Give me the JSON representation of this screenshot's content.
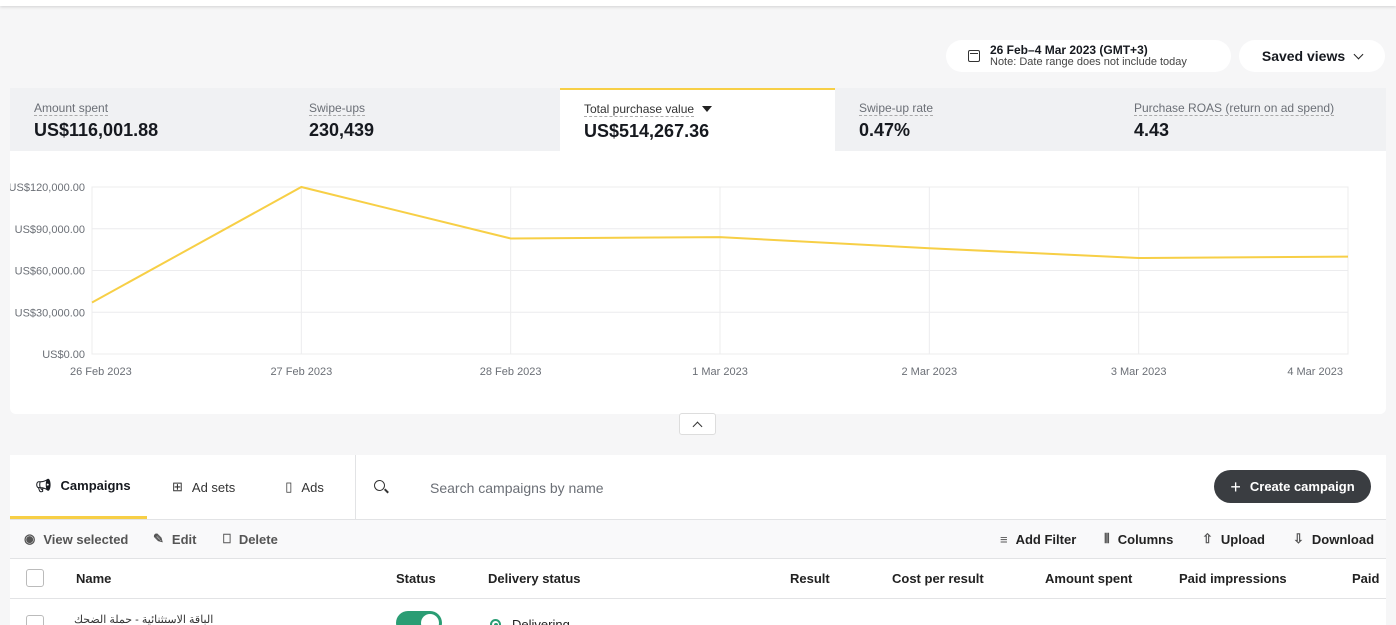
{
  "header": {
    "date_range": "26 Feb–4 Mar 2023 (GMT+3)",
    "date_note": "Note: Date range does not include today",
    "saved_views_label": "Saved views"
  },
  "metrics": [
    {
      "label": "Amount spent",
      "value": "US$116,001.88",
      "active": false
    },
    {
      "label": "Swipe-ups",
      "value": "230,439",
      "active": false
    },
    {
      "label": "Total purchase value",
      "value": "US$514,267.36",
      "active": true
    },
    {
      "label": "Swipe-up rate",
      "value": "0.47%",
      "active": false
    },
    {
      "label": "Purchase ROAS (return on ad spend)",
      "value": "4.43",
      "active": false
    }
  ],
  "chart_data": {
    "type": "line",
    "x": [
      "26 Feb 2023",
      "27 Feb 2023",
      "28 Feb 2023",
      "1 Mar 2023",
      "2 Mar 2023",
      "3 Mar 2023",
      "4 Mar 2023"
    ],
    "series": [
      {
        "values": [
          37000,
          120000,
          83000,
          84000,
          76000,
          69000,
          70000
        ]
      }
    ],
    "y_ticks": [
      "US$0.00",
      "US$30,000.00",
      "US$60,000.00",
      "US$90,000.00",
      "US$120,000.00"
    ],
    "ylim": [
      0,
      120000
    ],
    "color": "#f7cf46",
    "grid": true
  },
  "tabs": [
    {
      "label": "Campaigns",
      "icon": "megaphone-icon",
      "active": true
    },
    {
      "label": "Ad sets",
      "icon": "grid-icon",
      "active": false
    },
    {
      "label": "Ads",
      "icon": "phone-icon",
      "active": false
    }
  ],
  "search": {
    "placeholder": "Search campaigns by name"
  },
  "create_button": "Create campaign",
  "toolbar": {
    "view_selected": "View selected",
    "edit": "Edit",
    "delete": "Delete",
    "add_filter": "Add Filter",
    "columns": "Columns",
    "upload": "Upload",
    "download": "Download"
  },
  "table": {
    "columns": [
      "Name",
      "Status",
      "Delivery status",
      "Result",
      "Cost per result",
      "Amount spent",
      "Paid impressions",
      "Paid"
    ],
    "rows": [
      {
        "name": "الباقة الاستثنائية - حملة الضحك",
        "status_on": true,
        "delivery": "Delivering"
      }
    ]
  }
}
